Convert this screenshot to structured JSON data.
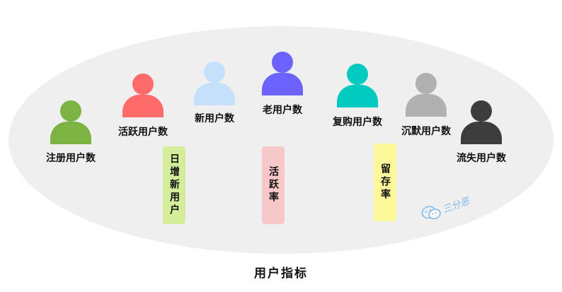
{
  "title": "用户指标",
  "colors": {
    "ellipse_fill": "#efefef",
    "registered": "#7cb342",
    "active": "#ff6b6b",
    "new": "#c5e0fb",
    "old": "#6c63ff",
    "repurchase": "#00c9c0",
    "silent": "#b0b0b0",
    "churned": "#3d3d3d",
    "tag_daily_new": "#d4ed9a",
    "tag_active_rate": "#f8c8c8",
    "tag_retention": "#fcf89a"
  },
  "users": {
    "registered": "注册用户数",
    "active": "活跃用户数",
    "new": "新用户数",
    "old": "老用户数",
    "repurchase": "复购用户数",
    "silent": "沉默用户数",
    "churned": "流失用户数"
  },
  "tags": {
    "daily_new": "日增新用户",
    "active_rate": "活跃率",
    "retention": "留存率"
  },
  "watermark": {
    "text": "三分恶",
    "icon": "wechat-icon"
  }
}
